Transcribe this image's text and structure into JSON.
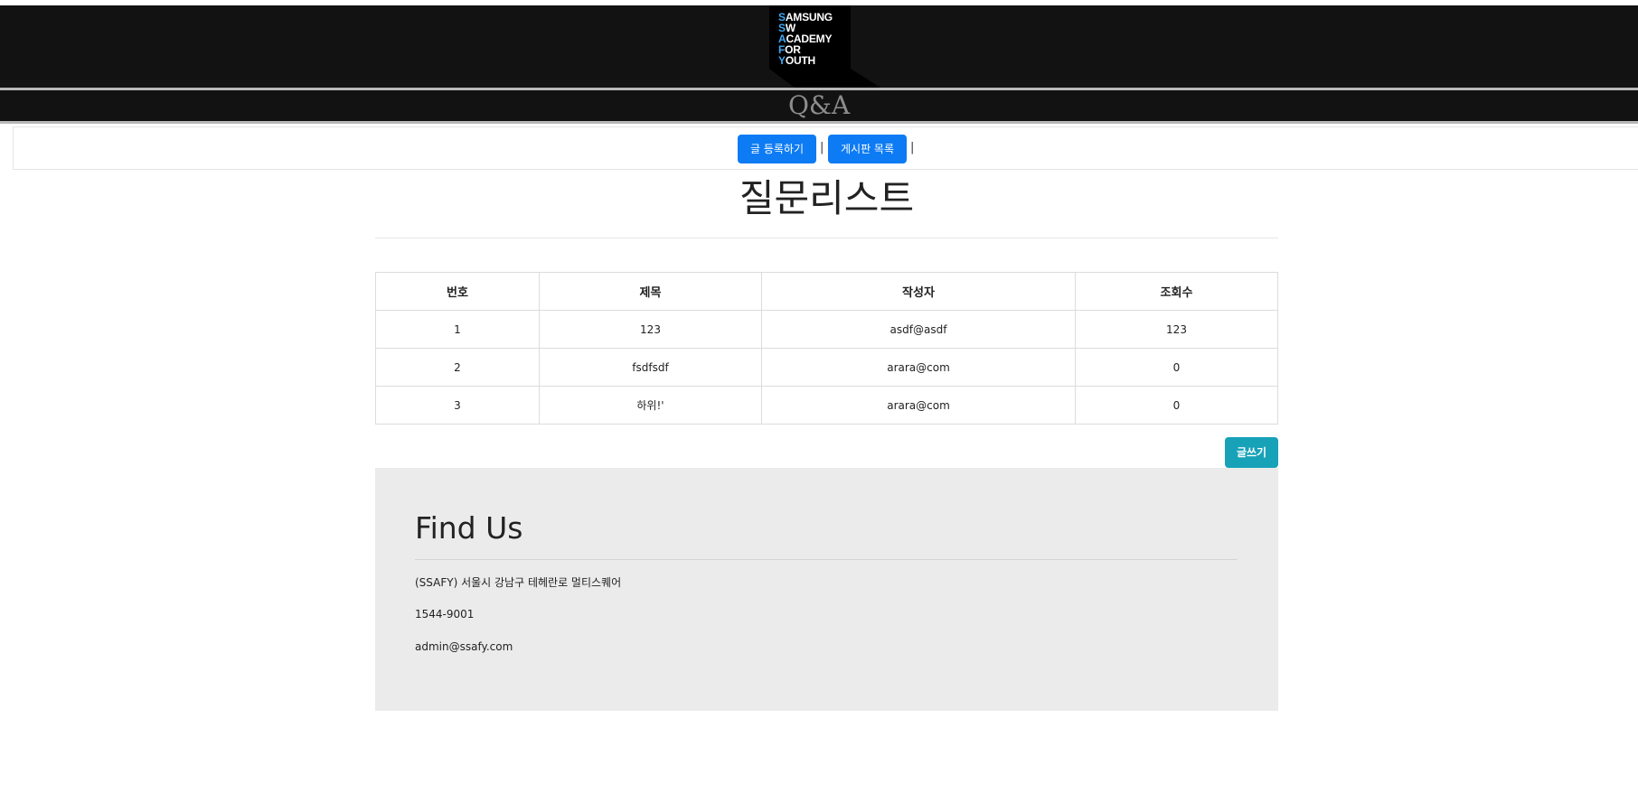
{
  "logo": {
    "lines": [
      {
        "first": "S",
        "rest": "AMSUNG"
      },
      {
        "first": "S",
        "rest": "W"
      },
      {
        "first": "A",
        "rest": "CADEMY"
      },
      {
        "first": "F",
        "rest": "OR"
      },
      {
        "first": "Y",
        "rest": "OUTH"
      }
    ],
    "accent_color": "#3fa9f5"
  },
  "header": {
    "subtitle": "Q&A"
  },
  "nav": {
    "register_label": "글 등록하기",
    "list_label": "게시판 목록",
    "separator": "|"
  },
  "main": {
    "title": "질문리스트",
    "table": {
      "headers": [
        "번호",
        "제목",
        "작성자",
        "조회수"
      ],
      "rows": [
        [
          "1",
          "123",
          "asdf@asdf",
          "123"
        ],
        [
          "2",
          "fsdfsdf",
          "arara@com",
          "0"
        ],
        [
          "3",
          "하위!'",
          "arara@com",
          "0"
        ]
      ]
    },
    "write_button": "글쓰기"
  },
  "footer": {
    "title": "Find Us",
    "address": "(SSAFY) 서울시 강남구 테헤란로 멀티스퀘어",
    "phone": "1544-9001",
    "email": "admin@ssafy.com"
  },
  "colors": {
    "header_bg": "#121212",
    "primary": "#0d7bf4",
    "info": "#17a2b8",
    "footer_bg": "#ebebeb"
  }
}
